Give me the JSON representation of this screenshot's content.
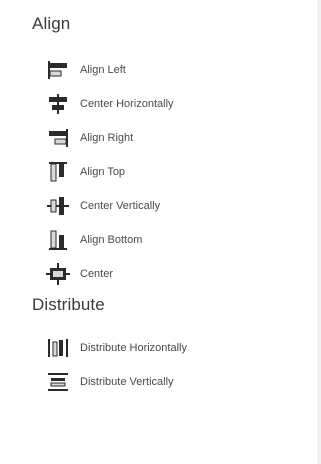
{
  "sections": {
    "align": {
      "title": "Align",
      "items": [
        {
          "label": "Align Left",
          "icon": "align-left-icon"
        },
        {
          "label": "Center Horizontally",
          "icon": "center-horizontally-icon"
        },
        {
          "label": "Align Right",
          "icon": "align-right-icon"
        },
        {
          "label": "Align Top",
          "icon": "align-top-icon"
        },
        {
          "label": "Center Vertically",
          "icon": "center-vertically-icon"
        },
        {
          "label": "Align Bottom",
          "icon": "align-bottom-icon"
        },
        {
          "label": "Center",
          "icon": "center-icon"
        }
      ]
    },
    "distribute": {
      "title": "Distribute",
      "items": [
        {
          "label": "Distribute Horizontally",
          "icon": "distribute-horizontally-icon"
        },
        {
          "label": "Distribute Vertically",
          "icon": "distribute-vertically-icon"
        }
      ]
    }
  },
  "colors": {
    "icon_dark": "#2b2b2b",
    "icon_light": "#d9d9d9",
    "text": "#4a4a4a"
  }
}
